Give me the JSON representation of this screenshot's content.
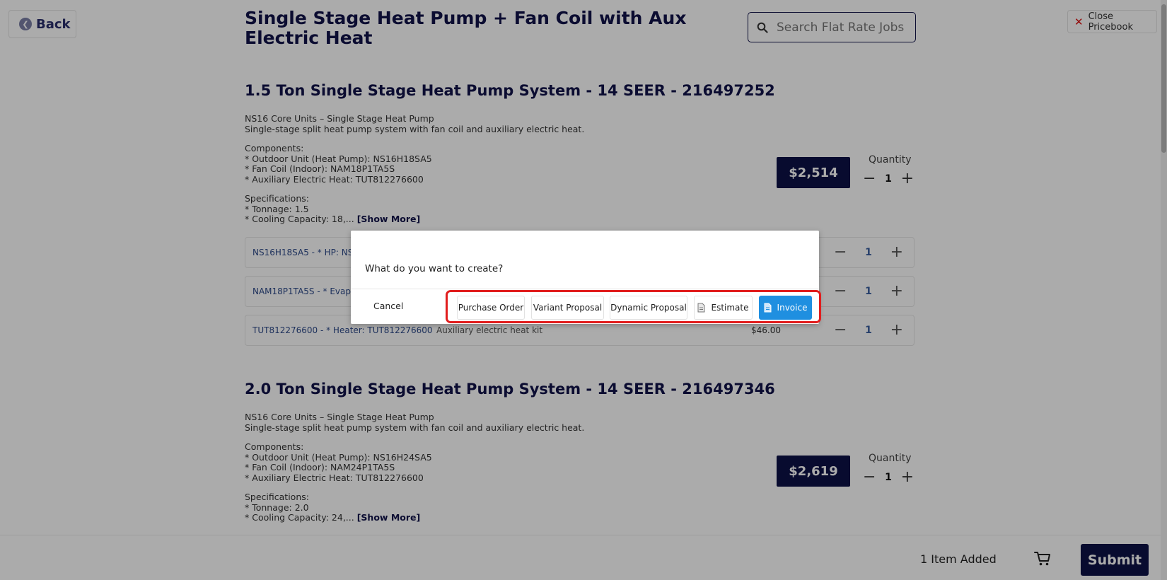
{
  "header": {
    "back_label": "Back",
    "page_title": "Single Stage Heat Pump + Fan Coil with Aux Electric Heat",
    "search_placeholder": "Search Flat Rate Jobs",
    "close_label": "Close Pricebook"
  },
  "sections": [
    {
      "title": "1.5 Ton Single Stage Heat Pump System - 14 SEER - 216497252",
      "line1": "NS16 Core Units – Single Stage Heat Pump",
      "line2": "Single-stage split heat pump system with fan coil and auxiliary electric heat.",
      "components_header": "Components:",
      "component_1": "* Outdoor Unit (Heat Pump): NS16H18SA5",
      "component_2": "* Fan Coil (Indoor): NAM18P1TA5S",
      "component_3": "* Auxiliary Electric Heat: TUT812276600",
      "specs_header": "Specifications:",
      "spec_1": "* Tonnage: 1.5",
      "spec_2": "* Cooling Capacity: 18,...",
      "show_more": "[Show More]",
      "price": "$2,514",
      "quantity_label": "Quantity",
      "quantity": "1",
      "rows": [
        {
          "code": "NS16H18SA5 - * HP: NS16",
          "desc": "",
          "price": "",
          "qty": "1"
        },
        {
          "code": "NAM18P1TA5S - * Evap Co",
          "desc": "",
          "price": "",
          "qty": "1"
        },
        {
          "code": "TUT812276600 - * Heater: TUT812276600",
          "desc": "Auxiliary electric heat kit",
          "price": "$46.00",
          "qty": "1"
        }
      ]
    },
    {
      "title": "2.0 Ton Single Stage Heat Pump System - 14 SEER - 216497346",
      "line1": "NS16 Core Units – Single Stage Heat Pump",
      "line2": "Single-stage split heat pump system with fan coil and auxiliary electric heat.",
      "components_header": "Components:",
      "component_1": "* Outdoor Unit (Heat Pump): NS16H24SA5",
      "component_2": "* Fan Coil (Indoor): NAM24P1TA5S",
      "component_3": "* Auxiliary Electric Heat: TUT812276600",
      "specs_header": "Specifications:",
      "spec_1": "* Tonnage: 2.0",
      "spec_2": "* Cooling Capacity: 24,...",
      "show_more": "[Show More]",
      "price": "$2,619",
      "quantity_label": "Quantity",
      "quantity": "1"
    }
  ],
  "footer": {
    "items_added": "1 Item Added",
    "submit_label": "Submit"
  },
  "dialog": {
    "question": "What do you want to create?",
    "cancel_label": "Cancel",
    "options": [
      "Purchase Order",
      "Variant Proposal",
      "Dynamic Proposal",
      "Estimate",
      "Invoice"
    ]
  },
  "colors": {
    "brand_navy": "#0d1146",
    "primary_blue": "#1f8fe0",
    "highlight_red": "#e11d1d"
  },
  "icons": {
    "back": "back-arrow-circle-icon",
    "search": "search-icon",
    "close": "close-x-icon",
    "cart": "cart-icon",
    "estimate": "document-icon",
    "invoice": "invoice-document-icon"
  }
}
